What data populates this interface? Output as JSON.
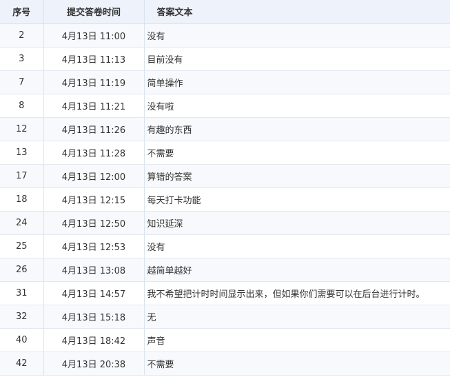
{
  "table": {
    "headers": {
      "seq": "序号",
      "time": "提交答卷时间",
      "answer": "答案文本"
    },
    "rows": [
      {
        "seq": "2",
        "time": "4月13日 11:00",
        "answer": "没有"
      },
      {
        "seq": "3",
        "time": "4月13日 11:13",
        "answer": "目前没有"
      },
      {
        "seq": "7",
        "time": "4月13日 11:19",
        "answer": "简单操作"
      },
      {
        "seq": "8",
        "time": "4月13日 11:21",
        "answer": "没有啦"
      },
      {
        "seq": "12",
        "time": "4月13日 11:26",
        "answer": "有趣的东西"
      },
      {
        "seq": "13",
        "time": "4月13日 11:28",
        "answer": "不需要"
      },
      {
        "seq": "17",
        "time": "4月13日 12:00",
        "answer": "算错的答案"
      },
      {
        "seq": "18",
        "time": "4月13日 12:15",
        "answer": "每天打卡功能"
      },
      {
        "seq": "24",
        "time": "4月13日 12:50",
        "answer": "知识延深"
      },
      {
        "seq": "25",
        "time": "4月13日 12:53",
        "answer": "没有"
      },
      {
        "seq": "26",
        "time": "4月13日 13:08",
        "answer": "越简单越好"
      },
      {
        "seq": "31",
        "time": "4月13日 14:57",
        "answer": "我不希望把计时时间显示出来，但如果你们需要可以在后台进行计时。"
      },
      {
        "seq": "32",
        "time": "4月13日 15:18",
        "answer": "无"
      },
      {
        "seq": "40",
        "time": "4月13日 18:42",
        "answer": "声音"
      },
      {
        "seq": "42",
        "time": "4月13日 20:38",
        "answer": "不需要"
      }
    ]
  },
  "colors": {
    "header_bg": "#eef3fb",
    "row_alt_bg": "#f7f9fc",
    "border": "#dbe3ee",
    "text": "#333333"
  }
}
